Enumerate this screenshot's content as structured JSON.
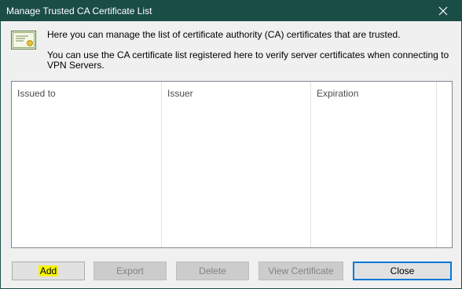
{
  "window": {
    "title": "Manage Trusted CA Certificate List",
    "title_bar_color": "#1b4d47"
  },
  "icons": {
    "close": "close-icon",
    "certificate": "certificate-icon"
  },
  "info": {
    "line1": "Here you can manage the list of certificate authority (CA) certificates that are trusted.",
    "line2": "You can use the CA certificate list registered here to verify server certificates when connecting to VPN Servers."
  },
  "list": {
    "columns": [
      "Issued to",
      "Issuer",
      "Expiration"
    ],
    "rows": []
  },
  "buttons": {
    "add": "Add",
    "export": "Export",
    "delete": "Delete",
    "view_certificate": "View Certificate",
    "close": "Close"
  },
  "highlight_color": "#f5f500"
}
